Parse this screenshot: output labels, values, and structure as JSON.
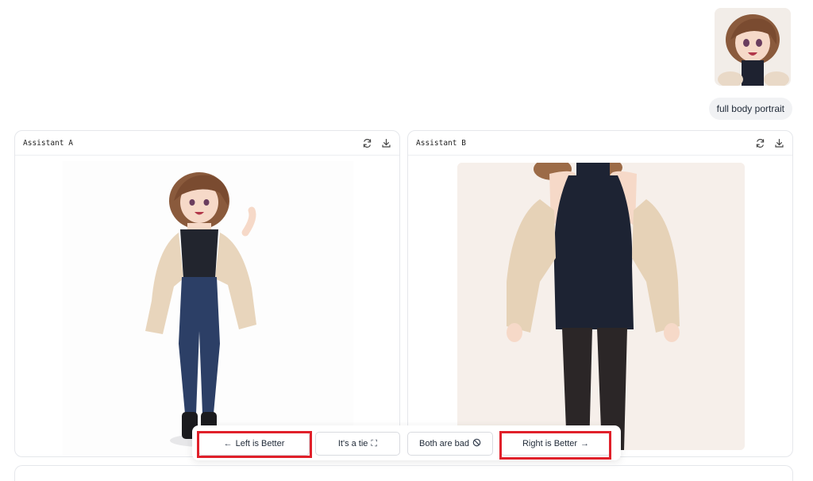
{
  "chat": {
    "prompt": "full body portrait"
  },
  "panels": {
    "left": {
      "title": "Assistant A"
    },
    "right": {
      "title": "Assistant B"
    }
  },
  "vote": {
    "left_label": "Left is Better",
    "left_glyph": "←",
    "tie_label": "It's a tie",
    "tie_glyph": "⛶",
    "bad_label": "Both are bad",
    "bad_glyph": "⃠",
    "right_label": "Right is Better",
    "right_glyph": "→"
  },
  "icons": {
    "regenerate": "refresh-icon",
    "download": "download-icon"
  },
  "colors": {
    "highlight": "#e0202a",
    "border": "#e5e7eb",
    "bubble": "#f1f2f4"
  }
}
